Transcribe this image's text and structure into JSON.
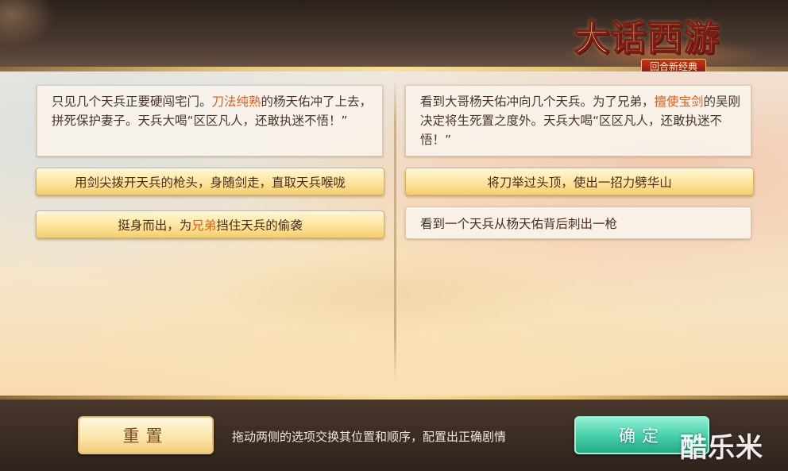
{
  "logo": {
    "title": "大话西游",
    "subtitle": "回合新经典"
  },
  "left": {
    "story": {
      "part1": "只见几个天兵正要硬闯宅门。",
      "highlight": "刀法纯熟",
      "part2": "的杨天佑冲了上去，拼死保护妻子。天兵大喝“区区凡人，还敢执迷不悟！”"
    },
    "option1": "用剑尖拨开天兵的枪头，身随剑走，直取天兵喉咙",
    "option2": {
      "part1": "挺身而出，为",
      "highlight": "兄弟",
      "part2": "挡住天兵的偷袭"
    }
  },
  "right": {
    "story": {
      "part1": "看到大哥杨天佑冲向几个天兵。为了兄弟，",
      "highlight": "擅使宝剑",
      "part2": "的吴刚决定将生死置之度外。天兵大喝“区区凡人，还敢执迷不悟！”"
    },
    "option1": "将刀举过头顶，使出一招力劈华山",
    "option2": "看到一个天兵从杨天佑背后刺出一枪"
  },
  "footer": {
    "reset_label": "重置",
    "hint": "拖动两侧的选项交换其位置和顺序，配置出正确剧情",
    "confirm_label": "确定"
  },
  "watermark": "酷乐米",
  "colors": {
    "highlight": "#e0601a",
    "text": "#4a3326",
    "confirm_button": "#43cfa7",
    "reset_button": "#fbe6aa"
  }
}
